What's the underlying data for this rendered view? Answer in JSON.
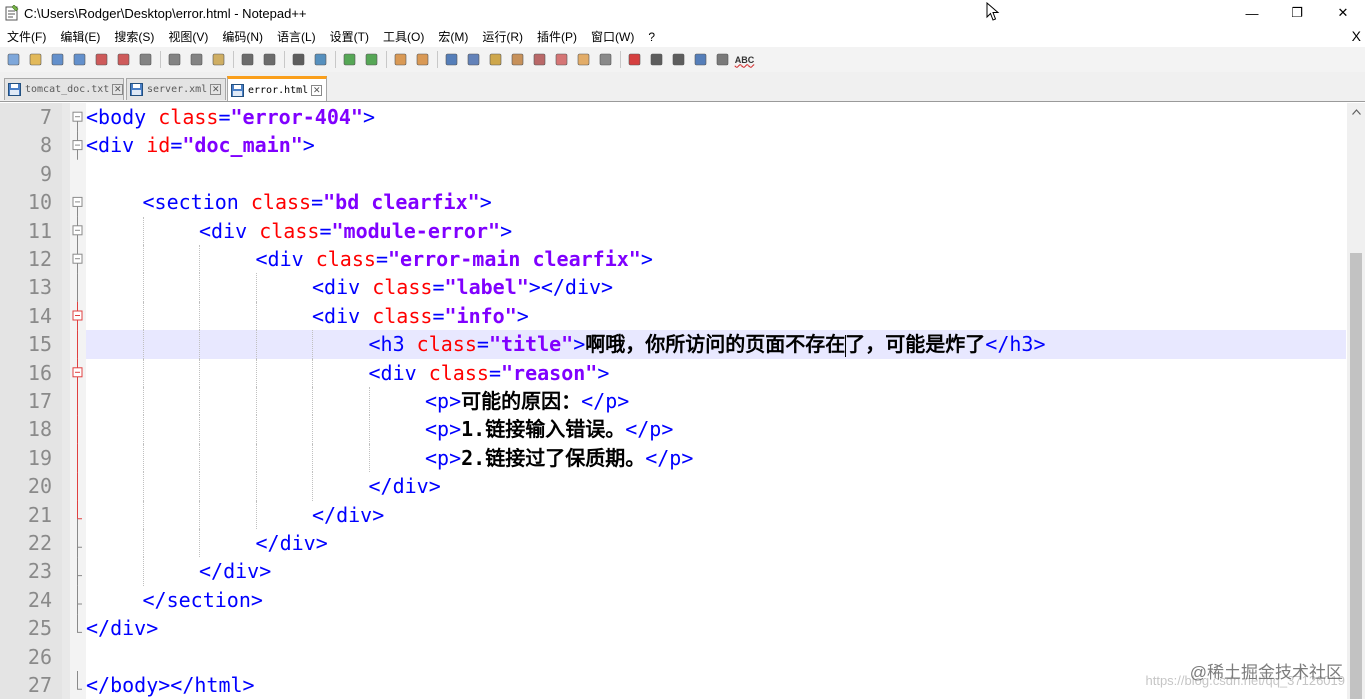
{
  "window": {
    "title": "C:\\Users\\Rodger\\Desktop\\error.html - Notepad++",
    "minimize_glyph": "—",
    "restore_glyph": "❐",
    "close_glyph": "✕"
  },
  "menu": {
    "items": [
      "文件(F)",
      "编辑(E)",
      "搜索(S)",
      "视图(V)",
      "编码(N)",
      "语言(L)",
      "设置(T)",
      "工具(O)",
      "宏(M)",
      "运行(R)",
      "插件(P)",
      "窗口(W)",
      "?"
    ],
    "close_glyph": "X"
  },
  "toolbar": {
    "icons": [
      "new-file-icon",
      "open-file-icon",
      "save-icon",
      "save-all-icon",
      "close-icon",
      "close-all-icon",
      "print-icon",
      "cut-icon",
      "copy-icon",
      "paste-icon",
      "undo-icon",
      "redo-icon",
      "find-icon",
      "replace-icon",
      "zoom-in-icon",
      "zoom-out-icon",
      "sync-v-icon",
      "sync-h-icon",
      "word-wrap-icon",
      "show-all-chars-icon",
      "indent-guide-icon",
      "udl-icon",
      "doc-map-icon",
      "function-list-icon",
      "folder-workspace-icon",
      "monitor-icon",
      "record-macro-icon",
      "stop-record-icon",
      "play-macro-icon",
      "run-multiple-icon",
      "save-macro-icon",
      "spellcheck-icon"
    ],
    "spellcheck_label": "ABC"
  },
  "tabs": [
    {
      "label": "tomcat_doc.txt",
      "active": false
    },
    {
      "label": "server.xml",
      "active": false
    },
    {
      "label": "error.html",
      "active": true
    }
  ],
  "editor": {
    "line_numbers": [
      "7",
      "8",
      "9",
      "10",
      "11",
      "12",
      "13",
      "14",
      "15",
      "16",
      "17",
      "18",
      "19",
      "20",
      "21",
      "22",
      "23",
      "24",
      "25",
      "26",
      "27"
    ],
    "current_line": "15",
    "lines": [
      {
        "indent": 0,
        "tokens": [
          {
            "t": "tag",
            "v": "<body "
          },
          {
            "t": "attr",
            "v": "class"
          },
          {
            "t": "eq",
            "v": "="
          },
          {
            "t": "val",
            "v": "\"error-404\""
          },
          {
            "t": "tag",
            "v": ">"
          }
        ]
      },
      {
        "indent": 0,
        "tokens": [
          {
            "t": "tag",
            "v": "<div "
          },
          {
            "t": "attr",
            "v": "id"
          },
          {
            "t": "eq",
            "v": "="
          },
          {
            "t": "val",
            "v": "\"doc_main\""
          },
          {
            "t": "tag",
            "v": ">"
          }
        ]
      },
      {
        "indent": 0,
        "tokens": []
      },
      {
        "indent": 1,
        "tokens": [
          {
            "t": "tag",
            "v": "<section "
          },
          {
            "t": "attr",
            "v": "class"
          },
          {
            "t": "eq",
            "v": "="
          },
          {
            "t": "val",
            "v": "\"bd clearfix\""
          },
          {
            "t": "tag",
            "v": ">"
          }
        ]
      },
      {
        "indent": 2,
        "tokens": [
          {
            "t": "tag",
            "v": "<div "
          },
          {
            "t": "attr",
            "v": "class"
          },
          {
            "t": "eq",
            "v": "="
          },
          {
            "t": "val",
            "v": "\"module-error\""
          },
          {
            "t": "tag",
            "v": ">"
          }
        ]
      },
      {
        "indent": 3,
        "tokens": [
          {
            "t": "tag",
            "v": "<div "
          },
          {
            "t": "attr",
            "v": "class"
          },
          {
            "t": "eq",
            "v": "="
          },
          {
            "t": "val",
            "v": "\"error-main clearfix\""
          },
          {
            "t": "tag",
            "v": ">"
          }
        ]
      },
      {
        "indent": 4,
        "tokens": [
          {
            "t": "tag",
            "v": "<div "
          },
          {
            "t": "attr",
            "v": "class"
          },
          {
            "t": "eq",
            "v": "="
          },
          {
            "t": "val",
            "v": "\"label\""
          },
          {
            "t": "tag",
            "v": "></div>"
          }
        ]
      },
      {
        "indent": 4,
        "tokens": [
          {
            "t": "tag",
            "v": "<div "
          },
          {
            "t": "attr",
            "v": "class"
          },
          {
            "t": "eq",
            "v": "="
          },
          {
            "t": "val",
            "v": "\"info\""
          },
          {
            "t": "tag",
            "v": ">"
          }
        ]
      },
      {
        "indent": 5,
        "tokens": [
          {
            "t": "tag",
            "v": "<h3 "
          },
          {
            "t": "attr",
            "v": "class"
          },
          {
            "t": "eq",
            "v": "="
          },
          {
            "t": "val",
            "v": "\"title\""
          },
          {
            "t": "tag",
            "v": ">"
          },
          {
            "t": "txt",
            "v": "啊哦，你所访问的页面不存在"
          },
          {
            "t": "txt",
            "v": "了，可能是炸了"
          },
          {
            "t": "tag",
            "v": "</h3>"
          }
        ]
      },
      {
        "indent": 5,
        "tokens": [
          {
            "t": "tag",
            "v": "<div "
          },
          {
            "t": "attr",
            "v": "class"
          },
          {
            "t": "eq",
            "v": "="
          },
          {
            "t": "val",
            "v": "\"reason\""
          },
          {
            "t": "tag",
            "v": ">"
          }
        ]
      },
      {
        "indent": 6,
        "tokens": [
          {
            "t": "tag",
            "v": "<p>"
          },
          {
            "t": "txt",
            "v": "可能的原因："
          },
          {
            "t": "tag",
            "v": "</p>"
          }
        ]
      },
      {
        "indent": 6,
        "tokens": [
          {
            "t": "tag",
            "v": "<p>"
          },
          {
            "t": "txt",
            "v": "1.链接输入错误。"
          },
          {
            "t": "tag",
            "v": "</p>"
          }
        ]
      },
      {
        "indent": 6,
        "tokens": [
          {
            "t": "tag",
            "v": "<p>"
          },
          {
            "t": "txt",
            "v": "2.链接过了保质期。"
          },
          {
            "t": "tag",
            "v": "</p>"
          }
        ]
      },
      {
        "indent": 5,
        "tokens": [
          {
            "t": "tag",
            "v": "</div>"
          }
        ]
      },
      {
        "indent": 4,
        "tokens": [
          {
            "t": "tag",
            "v": "</div>"
          }
        ]
      },
      {
        "indent": 3,
        "tokens": [
          {
            "t": "tag",
            "v": "</div>"
          }
        ]
      },
      {
        "indent": 2,
        "tokens": [
          {
            "t": "tag",
            "v": "</div>"
          }
        ]
      },
      {
        "indent": 1,
        "tokens": [
          {
            "t": "tag",
            "v": "</section>"
          }
        ]
      },
      {
        "indent": 0,
        "tokens": [
          {
            "t": "tag",
            "v": "</div>"
          }
        ]
      },
      {
        "indent": 0,
        "tokens": []
      },
      {
        "indent": 0,
        "tokens": [
          {
            "t": "tag",
            "v": "</body></html>"
          }
        ]
      }
    ],
    "fold_markers": [
      "minus",
      "minus",
      "none",
      "minus",
      "minus",
      "minus",
      "line",
      "minus-red",
      "line-red",
      "minus-red",
      "line-red",
      "line-red",
      "line-red",
      "line-red",
      "end-red",
      "end",
      "end",
      "end",
      "end",
      "none",
      "end"
    ]
  },
  "colors": {
    "tag": "#0000ff",
    "attribute": "#ff0000",
    "value": "#8000ff",
    "text": "#000000",
    "current_line_bg": "#e8e8ff",
    "active_tab_accent": "#fa9f1b"
  },
  "watermark": {
    "text": "@稀土掘金技术社区",
    "faint_url": "https://blog.csdn.net/qq_37126019"
  }
}
